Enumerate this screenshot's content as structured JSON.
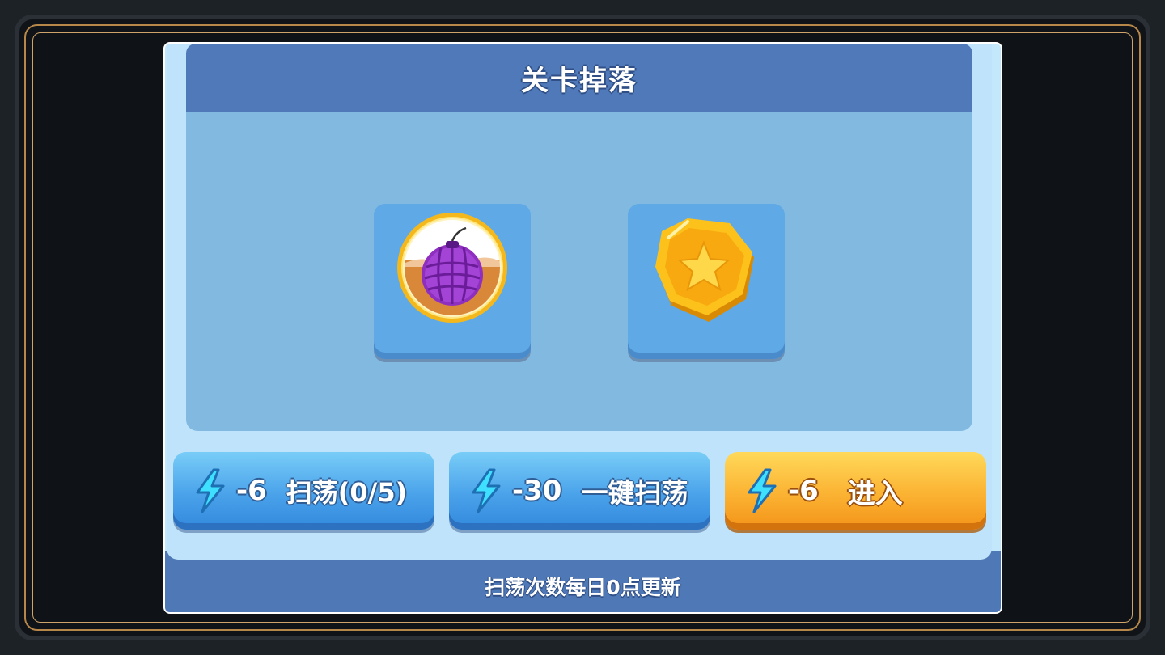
{
  "panel": {
    "title": "关卡掉落",
    "footer_note": "扫荡次数每日0点更新"
  },
  "drops": [
    {
      "icon": "purple-bomb-icon"
    },
    {
      "icon": "gold-star-coin-icon"
    }
  ],
  "buttons": [
    {
      "icon": "lightning-icon",
      "cost": "-6",
      "label": "扫荡(0/5)",
      "color": "#4aa2ea"
    },
    {
      "icon": "lightning-icon",
      "cost": "-30",
      "label": "一键扫荡",
      "color": "#4aa2ea"
    },
    {
      "icon": "lightning-icon",
      "cost": "-6",
      "label": "进入",
      "color": "#fbb232"
    }
  ]
}
